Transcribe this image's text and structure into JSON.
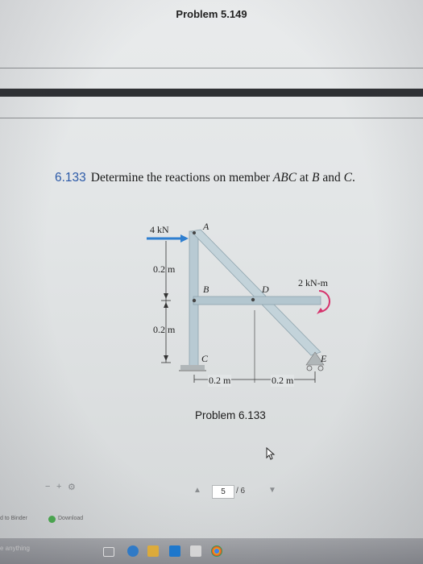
{
  "previous_page": {
    "title": "Problem 5.149"
  },
  "problem": {
    "number": "6.133",
    "text_pre": "Determine the reactions on member ",
    "member": "ABC",
    "text_mid": " at ",
    "point_b": "B",
    "text_and": " and ",
    "point_c": "C",
    "text_end": "."
  },
  "figure": {
    "force_label": "4 kN",
    "point_a": "A",
    "dim_vertical_top": "0.2 m",
    "point_b": "B",
    "point_d": "D",
    "moment_label": "2 kN-m",
    "dim_vertical_bottom": "0.2 m",
    "point_c": "C",
    "point_e": "E",
    "dim_horizontal_left": "0.2 m",
    "dim_horizontal_right": "0.2 m",
    "caption": "Problem 6.133"
  },
  "viewer": {
    "zoom_minus": "−",
    "zoom_plus": "+",
    "page_current": "5",
    "page_total": "/ 6"
  },
  "bottom_toolbar": {
    "add_to_binder": "d to Binder",
    "download": "Download"
  },
  "taskbar": {
    "search_placeholder": "e anything"
  },
  "colors": {
    "member_fill": "#b8cad3",
    "force_arrow": "#2f7fd0",
    "moment_arrow": "#d6336c",
    "problem_number": "#2c5aa8"
  }
}
